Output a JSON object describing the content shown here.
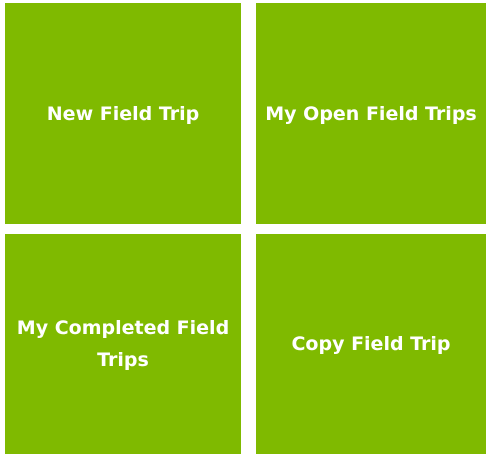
{
  "accent_color": "#7fba00",
  "text_color": "#ffffff",
  "tiles": [
    {
      "label": "New Field Trip"
    },
    {
      "label": "My Open Field Trips"
    },
    {
      "label": "My Completed Field Trips"
    },
    {
      "label": "Copy Field Trip"
    }
  ]
}
